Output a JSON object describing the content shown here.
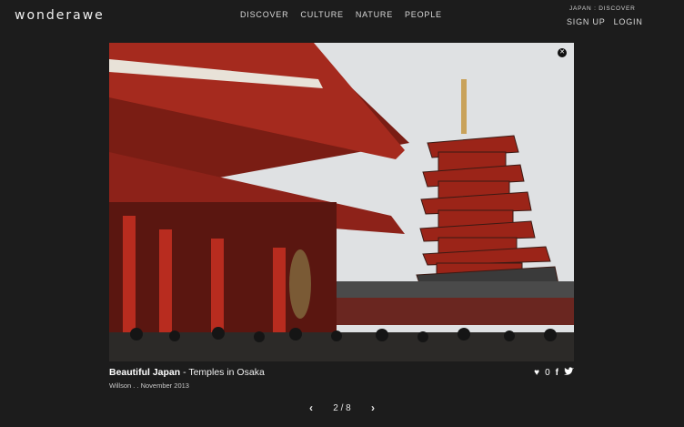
{
  "brand": {
    "logo_text": "wonderawe"
  },
  "nav": {
    "items": [
      "DISCOVER",
      "CULTURE",
      "NATURE",
      "PEOPLE"
    ]
  },
  "breadcrumb": "JAPAN : DISCOVER",
  "auth": {
    "signup": "SIGN UP",
    "login": "LOGIN"
  },
  "photo": {
    "title_bold": "Beautiful Japan",
    "title_rest": " - Temples in Osaka",
    "meta": "Willson . . November 2013",
    "likes": "0"
  },
  "pager": {
    "current_of_total": "2 / 8"
  },
  "icons": {
    "close": "close-icon",
    "heart": "heart-icon",
    "facebook": "facebook-icon",
    "twitter": "twitter-icon",
    "prev": "chevron-left-icon",
    "next": "chevron-right-icon"
  },
  "colors": {
    "background": "#1c1c1c",
    "text": "#e6e6e6",
    "temple_red": "#9b2418"
  }
}
